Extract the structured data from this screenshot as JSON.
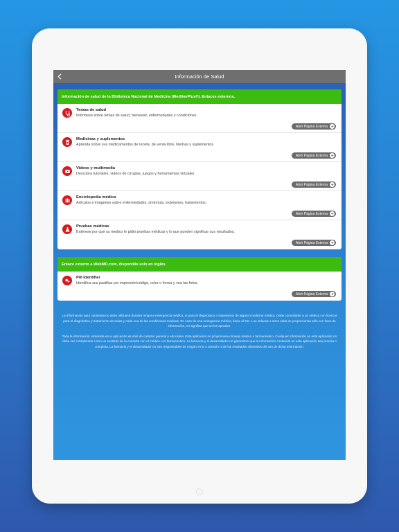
{
  "nav": {
    "title": "Información de Salud"
  },
  "section1": {
    "header": "Información de salud de la Biblioteca Nacional de Medicina (MedlinePlus®). Enlaces externos.",
    "items": [
      {
        "title": "Temas de salud",
        "desc": "Infórmese sobre temas de salud, bienestar, enfermedades y condiciones",
        "button": "Abrir Página Externa",
        "icon": "stethoscope-icon"
      },
      {
        "title": "Medicinas y suplementos",
        "desc": "Aprenda sobre sus medicamentos de receta, de venta libre, hierbas y suplementos",
        "button": "Abrir Página Externa",
        "icon": "pill-bottle-icon"
      },
      {
        "title": "Videos y multimedia",
        "desc": "Descubra tutoriales, videos de cirugías, juegos y herramientas virtuales",
        "button": "Abrir Página Externa",
        "icon": "video-play-icon"
      },
      {
        "title": "Enciclopedia médica",
        "desc": "Artículos e imágenes sobre enfermedades, síntomas, exámenes, tratamientos.",
        "button": "Abrir Página Externa",
        "icon": "books-icon"
      },
      {
        "title": "Pruebas médicas",
        "desc": "Entérese por qué su medico le pidió pruebas médicas y lo que pueden significar sus resultados.",
        "button": "Abrir Página Externa",
        "icon": "flask-icon"
      }
    ]
  },
  "section2": {
    "header": "Enlace externo a WebMD.com, disponible solo en inglés.",
    "items": [
      {
        "title": "Pill Identifier",
        "desc": "Identifica sus pastillas por impresión/código, color o forma y vea las fotos.",
        "button": "Abrir Página Externa",
        "icon": "pills-icon"
      }
    ]
  },
  "disclaimer": {
    "p1": "La información aquí contenida no debe utilizarse durante ninguna emergencia médica, ni para el diagnóstico o tratamiento de alguna condición médica. Debe consultarse a un médico con licencia para el diagnóstico y tratamiento de todas y cada una de las condiciones médicas. En caso de una emergencia médica, llame al 911. Los enlaces a otros sitios se proporcionan sólo con fines de información, no significa que se les apruebe.",
    "p2": "Toda la información contenida en la aplicación es sólo de carácter general y educativa. Esta aplicación no proporciona consejo médico o farmacéutico. Cualquier información en esta aplicación no debe ser considerado como un sustituto de la consulta con el médico o el farmacéutico. La farmacia y el desarrollador no garantizan que la información contenida en esta aplicación sea precisa o completa. La farmacia y el desarrollador no son responsables de ningún error u omisión ni de los resultados obtenidos del uso de dicha información."
  },
  "colors": {
    "header_green": "#3cbb10",
    "icon_red": "#d71920",
    "navbar": "#6f6f6f"
  }
}
